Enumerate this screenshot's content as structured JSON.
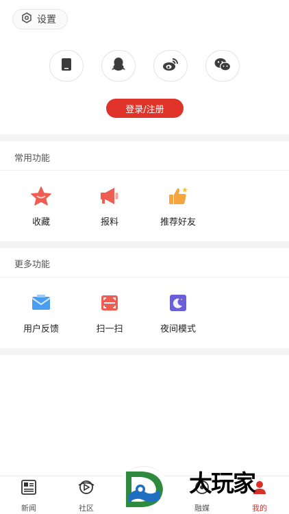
{
  "header": {
    "settings_label": "设置",
    "settings_icon": "hexagon-gear-icon"
  },
  "login": {
    "methods": [
      {
        "name": "phone",
        "icon": "phone-icon"
      },
      {
        "name": "qq",
        "icon": "qq-penguin-icon"
      },
      {
        "name": "weibo",
        "icon": "weibo-icon"
      },
      {
        "name": "wechat",
        "icon": "wechat-icon"
      }
    ],
    "button_label": "登录/注册"
  },
  "common_functions": {
    "title": "常用功能",
    "items": [
      {
        "label": "收藏",
        "icon": "star-icon"
      },
      {
        "label": "报料",
        "icon": "megaphone-icon"
      },
      {
        "label": "推荐好友",
        "icon": "thumbs-up-icon"
      }
    ]
  },
  "more_functions": {
    "title": "更多功能",
    "items": [
      {
        "label": "用户反馈",
        "icon": "envelope-icon"
      },
      {
        "label": "扫一扫",
        "icon": "scan-icon"
      },
      {
        "label": "夜间模式",
        "icon": "moon-icon"
      }
    ]
  },
  "tabbar": {
    "tabs": [
      {
        "label": "新闻",
        "icon": "newspaper-icon",
        "active": false
      },
      {
        "label": "社区",
        "icon": "orbit-icon",
        "active": false
      },
      {
        "label": "融媒",
        "icon": "media-icon",
        "active": false
      },
      {
        "label": "我的",
        "icon": "person-icon",
        "active": true
      }
    ],
    "center_logo": "app-logo-icon"
  },
  "watermark": {
    "text": "大玩家"
  },
  "colors": {
    "accent": "#e0342a",
    "active_tab": "#d8302a",
    "band": "#f3f3f3"
  }
}
